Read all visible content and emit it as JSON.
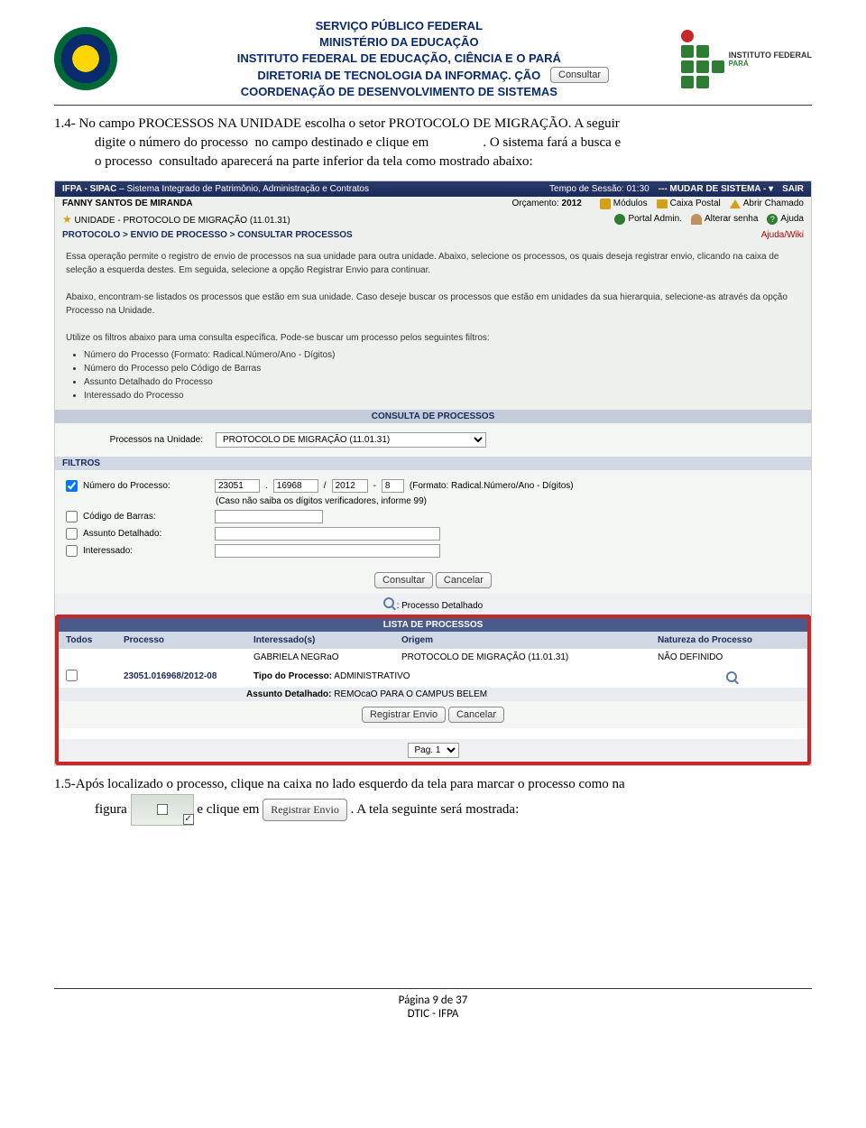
{
  "header": {
    "line1": "SERVIÇO PÚBLICO FEDERAL",
    "line2": "MINISTÉRIO DA EDUCAÇÃO",
    "line3": "INSTITUTO FEDERAL DE EDUCAÇÃO, CIÊNCIA E                     O PARÁ",
    "line4": "DIRETORIA DE TECNOLOGIA DA INFORMAÇ.                   ÇÃO",
    "line5": "COORDENAÇÃO DE DESENVOLVIMENTO DE SISTEMAS",
    "consultar_btn": "Consultar",
    "if_label": "INSTITUTO FEDERAL",
    "if_sub": "PARÁ"
  },
  "para14": "1.4- No campo PROCESSOS NA UNIDADE escolha o setor PROTOCOLO DE MIGRAÇÃO. A seguir digite o número do processo  no campo destinado e clique em                 . O sistema fará a busca e o processo  consultado aparecerá na parte inferior da tela como mostrado abaixo:",
  "sipac": {
    "topbar_title": "IFPA - SIPAC",
    "topbar_sub": " – Sistema Integrado de Patrimônio, Administração e Contratos",
    "tempo": "Tempo de Sessão: 01:30",
    "mudar": "--- MUDAR DE SISTEMA - ",
    "sair": "SAIR",
    "user": "FANNY SANTOS DE MIRANDA",
    "orcamento_l": "Orçamento:",
    "orcamento_v": "2012",
    "unidade": "UNIDADE - PROTOCOLO DE MIGRAÇÃO (11.01.31)",
    "modulos": "Módulos",
    "caixa": "Caixa Postal",
    "abrir": "Abrir Chamado",
    "portal": "Portal Admin.",
    "alterar": "Alterar senha",
    "ajuda": "Ajuda",
    "breadcrumb": "PROTOCOLO > ENVIO DE PROCESSO > CONSULTAR PROCESSOS",
    "wiki": "Ajuda/Wiki",
    "desc1": "Essa operação permite o registro de envio de processos na sua unidade para outra unidade. Abaixo, selecione os processos, os quais deseja registrar envio, clicando na caixa de seleção a esquerda destes. Em seguida, selecione a opção Registrar Envio para continuar.",
    "desc2": "Abaixo, encontram-se listados os processos que estão em sua unidade. Caso deseje buscar os processos que estão em unidades da sua hierarquia, selecione-as através da opção Processo na Unidade.",
    "desc3": "Utilize os filtros abaixo para uma consulta específica. Pode-se buscar um processo pelos seguintes filtros:",
    "bullets": [
      "Número do Processo (Formato: Radical.Número/Ano - Dígitos)",
      "Número do Processo pelo Código de Barras",
      "Assunto Detalhado do Processo",
      "Interessado do Processo"
    ],
    "consulta_title": "CONSULTA DE PROCESSOS",
    "proc_unidade_l": "Processos na Unidade:",
    "proc_unidade_v": "PROTOCOLO DE MIGRAÇÃO (11.01.31)",
    "filtros": "FILTROS",
    "num_proc_l": "Número do Processo:",
    "num1": "23051",
    "num2": "16968",
    "num3": "2012",
    "num4": "8",
    "num_fmt": "(Formato: Radical.Número/Ano - Dígitos)",
    "num_hint": "(Caso não saiba os dígitos verificadores, informe 99)",
    "cod_barras_l": "Código de Barras:",
    "assunto_l": "Assunto Detalhado:",
    "interessado_l": "Interessado:",
    "btn_consultar": "Consultar",
    "btn_cancelar": "Cancelar",
    "detalhado": ": Processo Detalhado",
    "lista_title": "LISTA DE PROCESSOS",
    "th_todos": "Todos",
    "th_processo": "Processo",
    "th_interessados": "Interessado(s)",
    "th_origem": "Origem",
    "th_natureza": "Natureza do Processo",
    "row_proc": "23051.016968/2012-08",
    "row_inter": "GABRIELA NEGRaO",
    "row_origem": "PROTOCOLO DE MIGRAÇÃO (11.01.31)",
    "row_nat": "NÃO DEFINIDO",
    "row_tipo_l": "Tipo do Processo:",
    "row_tipo_v": "ADMINISTRATIVO",
    "row_ass_l": "Assunto Detalhado:",
    "row_ass_v": "REMOcaO PARA O CAMPUS BELEM",
    "btn_reg": "Registrar Envio",
    "btn_cancel2": "Cancelar",
    "pag": "Pag. 1"
  },
  "para15_a": "1.5-Após localizado o processo,  clique na caixa no lado esquerdo da tela para marcar o processo  como na",
  "para15_b": "figura",
  "para15_c": " e clique em ",
  "para15_d": ". A tela seguinte será mostrada:",
  "reg_envio_btn": "Registrar Envio",
  "footer": {
    "pagina": "Página 9 de 37",
    "dtic": "DTIC - IFPA"
  }
}
